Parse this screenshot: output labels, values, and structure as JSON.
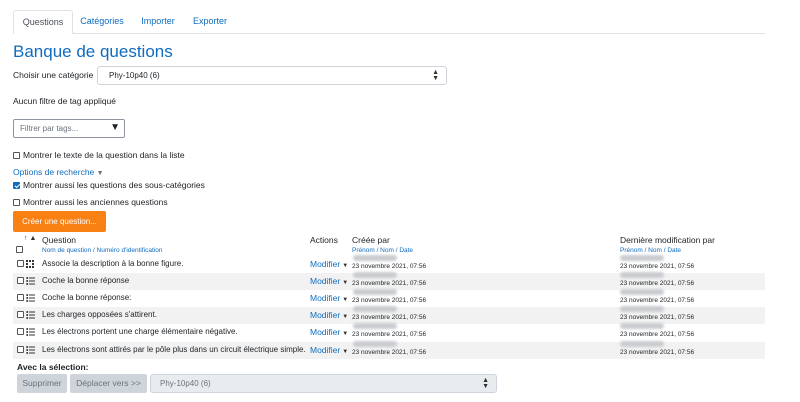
{
  "tabs": [
    {
      "label": "Questions",
      "active": true
    },
    {
      "label": "Catégories",
      "active": false
    },
    {
      "label": "Importer",
      "active": false
    },
    {
      "label": "Exporter",
      "active": false
    }
  ],
  "page_title": "Banque de questions",
  "category": {
    "label": "Choisir une catégorie",
    "selected": "Phy-10p40 (6)"
  },
  "no_tag_filter": "Aucun filtre de tag appliqué",
  "tag_filter_placeholder": "Filtrer par tags...",
  "options": {
    "show_text": {
      "label": "Montrer le texte de la question dans la liste",
      "checked": false
    },
    "search_options_link": "Options de recherche",
    "subcategories": {
      "label": "Montrer aussi les questions des sous-catégories",
      "checked": true
    },
    "old_questions": {
      "label": "Montrer aussi les anciennes questions",
      "checked": false
    }
  },
  "create_button": "Créer une question...",
  "table": {
    "headers": {
      "sort_indicator": "↑ ▲",
      "question": "Question",
      "question_sub": "Nom de question / Numéro d'identification",
      "actions": "Actions",
      "created_by": "Créée par",
      "created_sub": "Prénom / Nom / Date",
      "modified_by": "Dernière modification par",
      "modified_sub": "Prénom / Nom / Date"
    },
    "action_label": "Modifier",
    "rows": [
      {
        "question": "Associe la description à la bonne figure.",
        "icon": "drag-drop-icon",
        "created": "23 novembre 2021, 07:56",
        "modified": "23 novembre 2021, 07:56"
      },
      {
        "question": "Coche la bonne réponse",
        "icon": "multichoice-icon",
        "created": "23 novembre 2021, 07:56",
        "modified": "23 novembre 2021, 07:56"
      },
      {
        "question": "Coche la bonne réponse:",
        "icon": "multichoice-icon",
        "created": "23 novembre 2021, 07:56",
        "modified": "23 novembre 2021, 07:56"
      },
      {
        "question": "Les charges opposées s'attirent.",
        "icon": "multichoice-icon",
        "created": "23 novembre 2021, 07:56",
        "modified": "23 novembre 2021, 07:56"
      },
      {
        "question": "Les électrons portent une charge élémentaire négative.",
        "icon": "multichoice-icon",
        "created": "23 novembre 2021, 07:56",
        "modified": "23 novembre 2021, 07:56"
      },
      {
        "question": "Les électrons sont attirés par le pôle plus dans un circuit électrique simple.",
        "icon": "multichoice-icon",
        "created": "23 novembre 2021, 07:56",
        "modified": "23 novembre 2021, 07:56"
      }
    ]
  },
  "bulk": {
    "title": "Avec la sélection:",
    "delete_button": "Supprimer",
    "move_button": "Déplacer vers >>",
    "target_category": "Phy-10p40 (6)"
  },
  "colors": {
    "accent": "#0f6cbf",
    "create_button": "#f98012",
    "row_alt": "#f2f2f2"
  }
}
